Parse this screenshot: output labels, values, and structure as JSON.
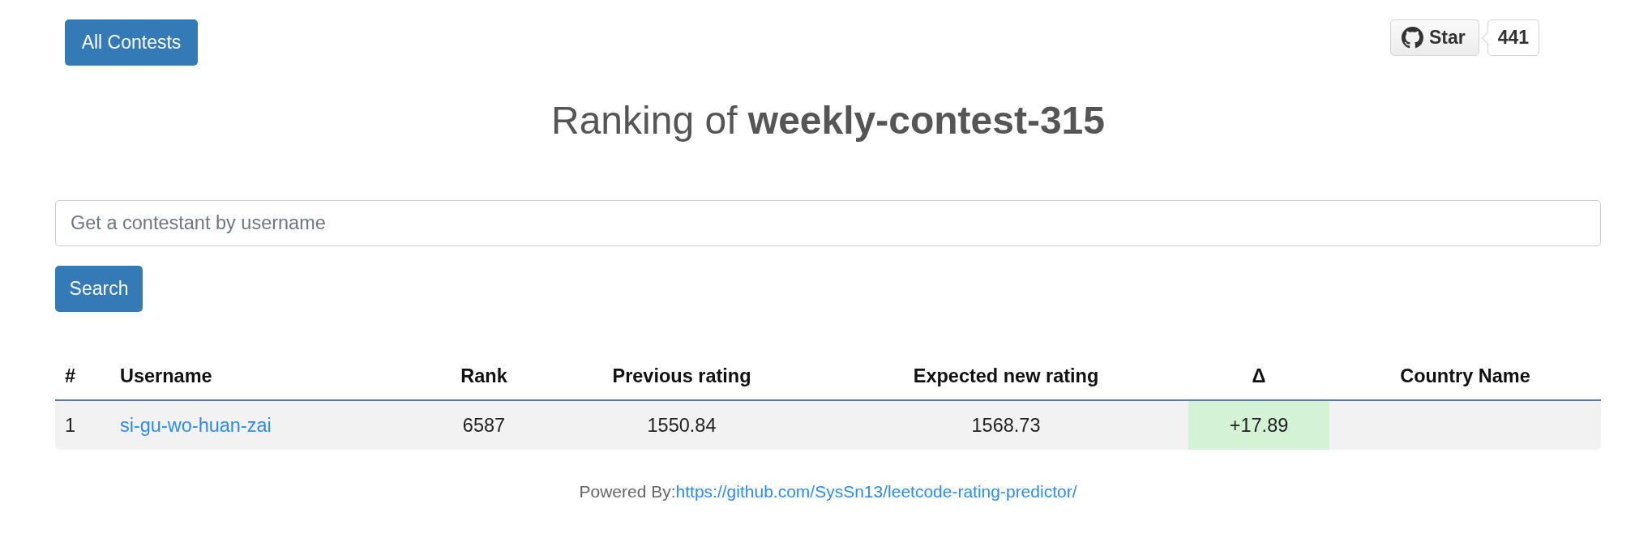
{
  "header": {
    "all_contests_button": "All Contests",
    "star_button": {
      "label": "Star",
      "count": "441"
    }
  },
  "title": "Ranking of **weekly-contest-315**",
  "search": {
    "placeholder": "Get a contestant by username",
    "button": "Search"
  },
  "table": {
    "columns": [
      "#",
      "Username",
      "Rank",
      "Previous rating",
      "Expected new rating",
      "Δ",
      "Country Name"
    ],
    "rows": [
      {
        "number": "1",
        "username": "si-gu-wo-huan-zai",
        "rank": "6587",
        "previous_rating": "1550.84",
        "expected_new_rating": "1568.73",
        "delta": {
          "text": "+17.89",
          "color": "#d4f2d6"
        }
      }
    ]
  },
  "footer": {
    "label": "Powered By:",
    "link": "https://github.com/SysSn13/leetcode-rating-predictor/"
  }
}
